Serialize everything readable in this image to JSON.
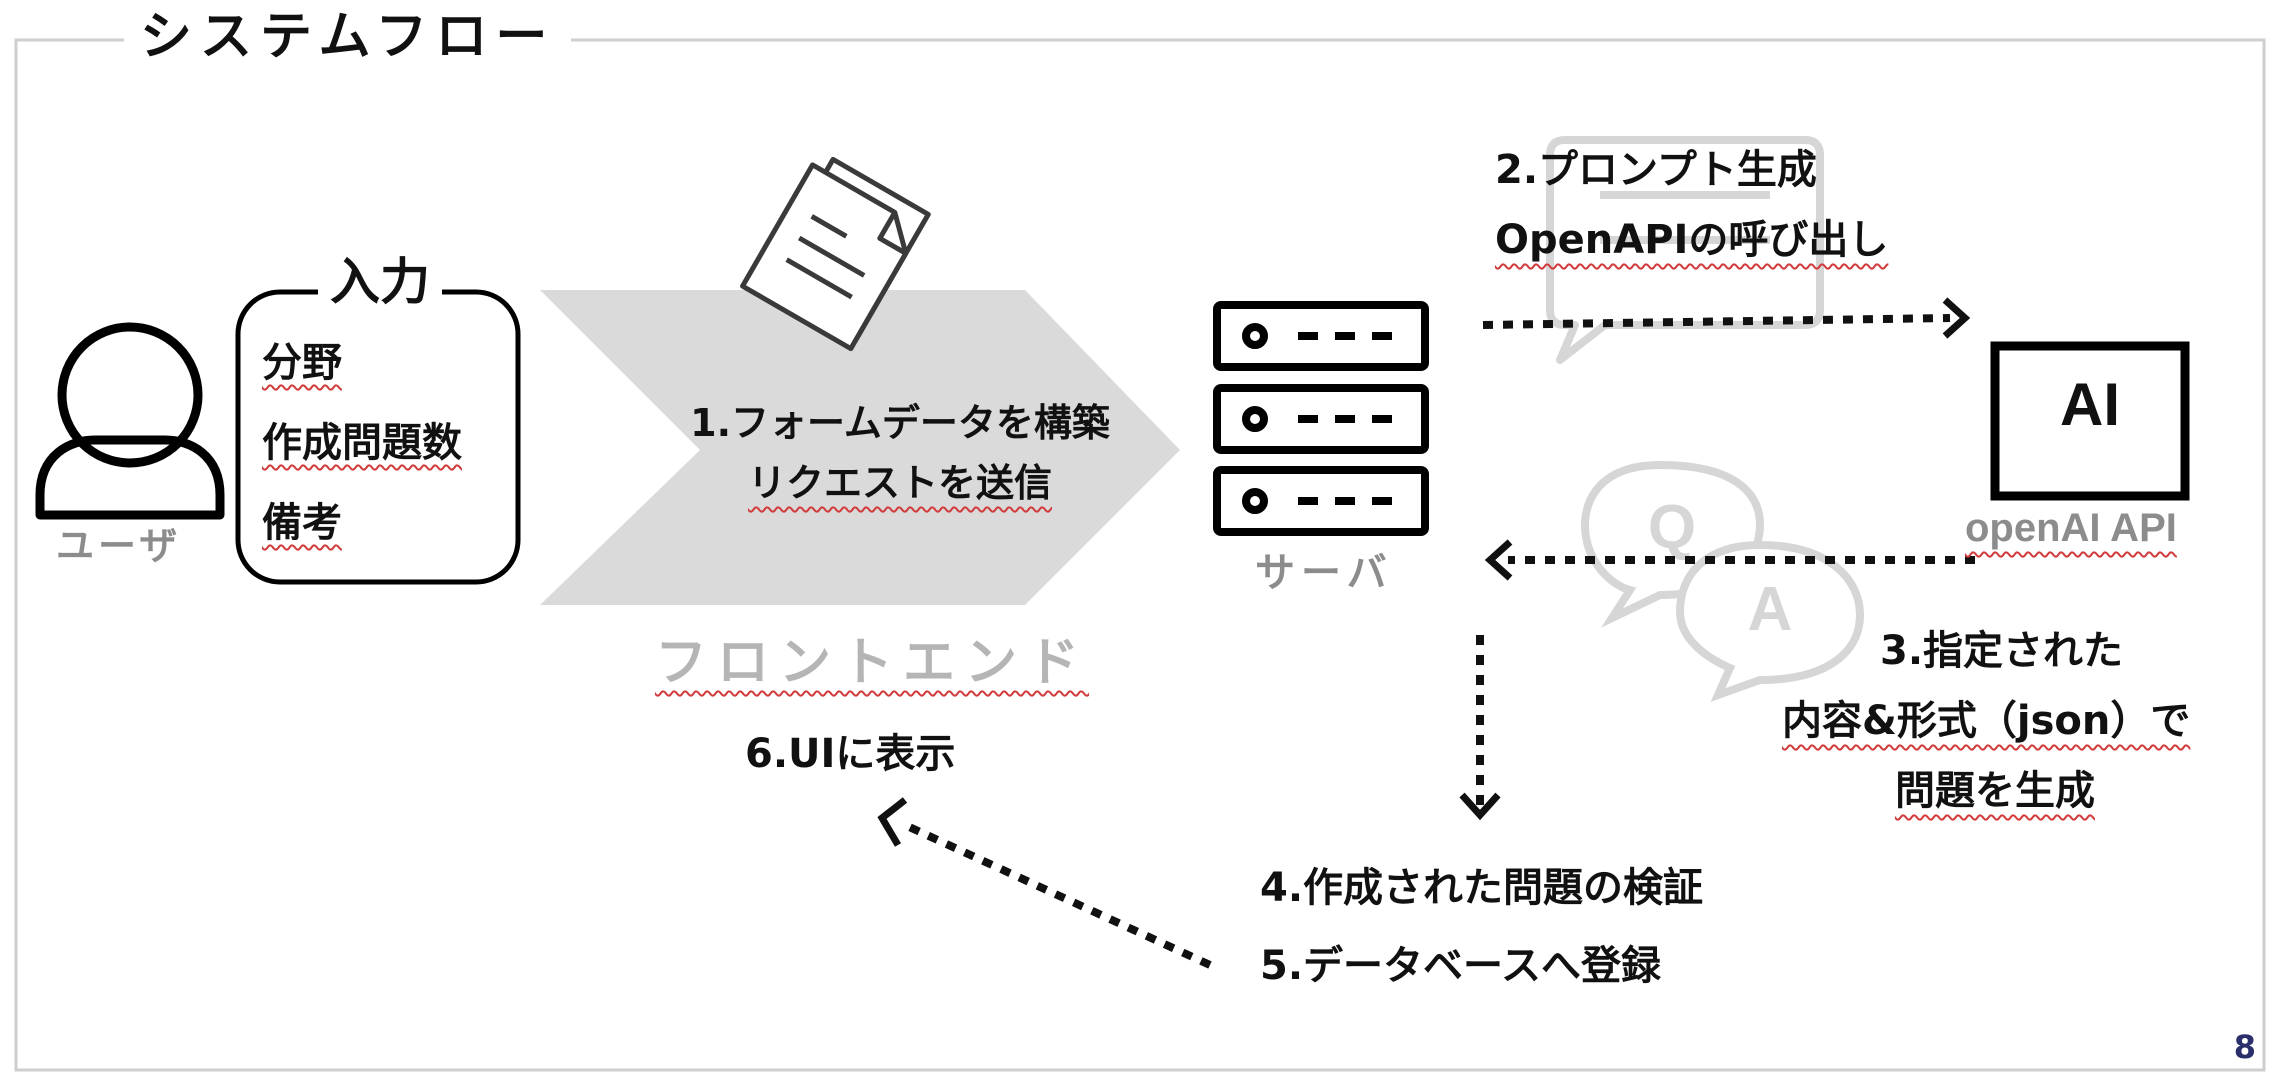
{
  "slide": {
    "title": "システムフロー",
    "page_number": "8"
  },
  "actors": {
    "user_label": "ユーザ",
    "frontend_label": "フロントエンド",
    "server_label": "サーバ",
    "ai_box_text": "AI",
    "ai_label": "openAI API"
  },
  "input_box": {
    "title": "入力",
    "fields": [
      "分野",
      "作成問題数",
      "備考"
    ]
  },
  "steps": {
    "step1_line1": "1.フォームデータを構築",
    "step1_line2": "リクエストを送信",
    "step2_line1": "2.プロンプト生成",
    "step2_line2": "OpenAPIの呼び出し",
    "step3_line1": "3.指定された",
    "step3_line2": "内容&形式（json）で",
    "step3_line3": "問題を生成",
    "step4": "4.作成された問題の検証",
    "step5": "5.データベースへ登録",
    "step6": "6.UIに表示"
  },
  "decorations": {
    "qa_bubble_left": "Q",
    "qa_bubble_right": "A"
  },
  "colors": {
    "frame": "#cfcfcf",
    "chevron": "#dadada",
    "icon_gray": "#d6d6d6",
    "label_gray": "#8c8c8c",
    "page_number": "#2a2f6b",
    "spellcheck_underline": "#d23b3b"
  }
}
